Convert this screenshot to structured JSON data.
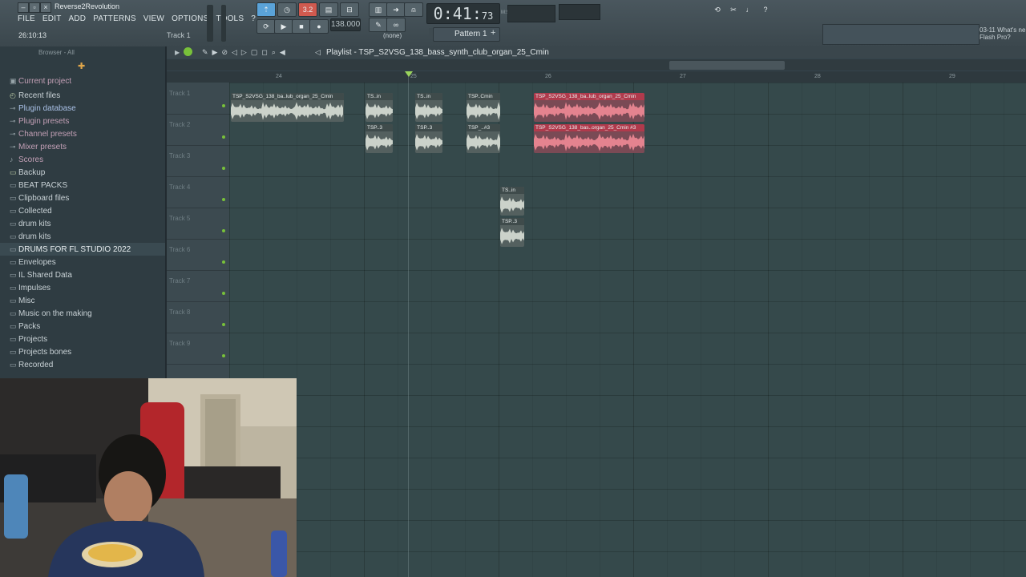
{
  "window": {
    "title": "Reverse2Revolution"
  },
  "menu": [
    "FILE",
    "EDIT",
    "ADD",
    "PATTERNS",
    "VIEW",
    "OPTIONS",
    "TOOLS",
    "?"
  ],
  "hint_bar": {
    "time": "26:10:13",
    "track": "Track 1"
  },
  "transport": {
    "tempo": "138.000",
    "time_main": "0:41",
    "time_sub": "73",
    "time_unit": "M:S:CS",
    "pattern": "Pattern 1",
    "none_label": "(none)",
    "countin": "3.2"
  },
  "news": {
    "line1": "03-11  What's ne",
    "line2": "Flash Pro?"
  },
  "browser": {
    "header": "Browser - All",
    "items": [
      {
        "label": "Current project",
        "icon": "project-icon",
        "kind": "pink"
      },
      {
        "label": "Recent files",
        "icon": "clock-icon",
        "kind": "folder"
      },
      {
        "label": "Plugin database",
        "icon": "plug-icon",
        "kind": "special"
      },
      {
        "label": "Plugin presets",
        "icon": "plug-icon",
        "kind": "pink"
      },
      {
        "label": "Channel presets",
        "icon": "plug-icon",
        "kind": "pink"
      },
      {
        "label": "Mixer presets",
        "icon": "plug-icon",
        "kind": "pink"
      },
      {
        "label": "Scores",
        "icon": "note-icon",
        "kind": "pink"
      },
      {
        "label": "Backup",
        "icon": "folder-icon",
        "kind": "folder"
      },
      {
        "label": "BEAT PACKS",
        "icon": "folder-icon",
        "kind": ""
      },
      {
        "label": "Clipboard files",
        "icon": "folder-icon",
        "kind": ""
      },
      {
        "label": "Collected",
        "icon": "folder-icon",
        "kind": ""
      },
      {
        "label": "drum kits",
        "icon": "folder-icon",
        "kind": ""
      },
      {
        "label": "drum kits",
        "icon": "folder-icon",
        "kind": ""
      },
      {
        "label": "DRUMS FOR FL STUDIO 2022",
        "icon": "folder-icon",
        "kind": "hl"
      },
      {
        "label": "Envelopes",
        "icon": "folder-icon",
        "kind": ""
      },
      {
        "label": "IL Shared Data",
        "icon": "folder-icon",
        "kind": ""
      },
      {
        "label": "Impulses",
        "icon": "folder-icon",
        "kind": ""
      },
      {
        "label": "Misc",
        "icon": "folder-icon",
        "kind": ""
      },
      {
        "label": "Music on the making",
        "icon": "folder-icon",
        "kind": ""
      },
      {
        "label": "Packs",
        "icon": "folder-icon",
        "kind": ""
      },
      {
        "label": "Projects",
        "icon": "folder-icon",
        "kind": ""
      },
      {
        "label": "Projects bones",
        "icon": "folder-icon",
        "kind": ""
      },
      {
        "label": "Recorded",
        "icon": "folder-icon",
        "kind": ""
      }
    ]
  },
  "playlist": {
    "title": "Playlist - TSP_S2VSG_138_bass_synth_club_organ_25_Cmin",
    "bar_numbers": [
      "24",
      "25",
      "26",
      "27",
      "28",
      "29"
    ],
    "tracks": [
      "Track 1",
      "Track 2",
      "Track 3",
      "Track 4",
      "Track 5",
      "Track 6",
      "Track 7",
      "Track 8",
      "Track 9"
    ],
    "clips": [
      {
        "label": "TSP_S2VSG_138_ba..lub_organ_25_Cmin",
        "color": "gray",
        "track": 1,
        "bar_start": 24.0,
        "bar_len": 0.84
      },
      {
        "label": "TS..in",
        "color": "gray",
        "track": 1,
        "bar_start": 25.0,
        "bar_len": 0.2
      },
      {
        "label": "TS..in",
        "color": "gray",
        "track": 1,
        "bar_start": 25.37,
        "bar_len": 0.2
      },
      {
        "label": "TSP..Cmin",
        "color": "gray",
        "track": 1,
        "bar_start": 25.75,
        "bar_len": 0.25
      },
      {
        "label": "TSP_S2VSG_138_ba..lub_organ_25_Cmin",
        "color": "red",
        "track": 1,
        "bar_start": 26.25,
        "bar_len": 0.82
      },
      {
        "label": "TSP..3",
        "color": "gray",
        "track": 2,
        "bar_start": 25.0,
        "bar_len": 0.2
      },
      {
        "label": "TSP..3",
        "color": "gray",
        "track": 2,
        "bar_start": 25.37,
        "bar_len": 0.2
      },
      {
        "label": "TSP_..#3",
        "color": "gray",
        "track": 2,
        "bar_start": 25.75,
        "bar_len": 0.25
      },
      {
        "label": "TSP_S2VSG_138_bas..organ_25_Cmin #3",
        "color": "red",
        "track": 2,
        "bar_start": 26.25,
        "bar_len": 0.82
      },
      {
        "label": "TS..in",
        "color": "gray",
        "track": 4,
        "bar_start": 26.0,
        "bar_len": 0.18
      },
      {
        "label": "TSP..3",
        "color": "gray",
        "track": 5,
        "bar_start": 26.0,
        "bar_len": 0.18
      }
    ]
  },
  "colors": {
    "accent_green": "#78c13a",
    "clip_red": "#b03a4c",
    "clip_gray": "#54605f"
  }
}
